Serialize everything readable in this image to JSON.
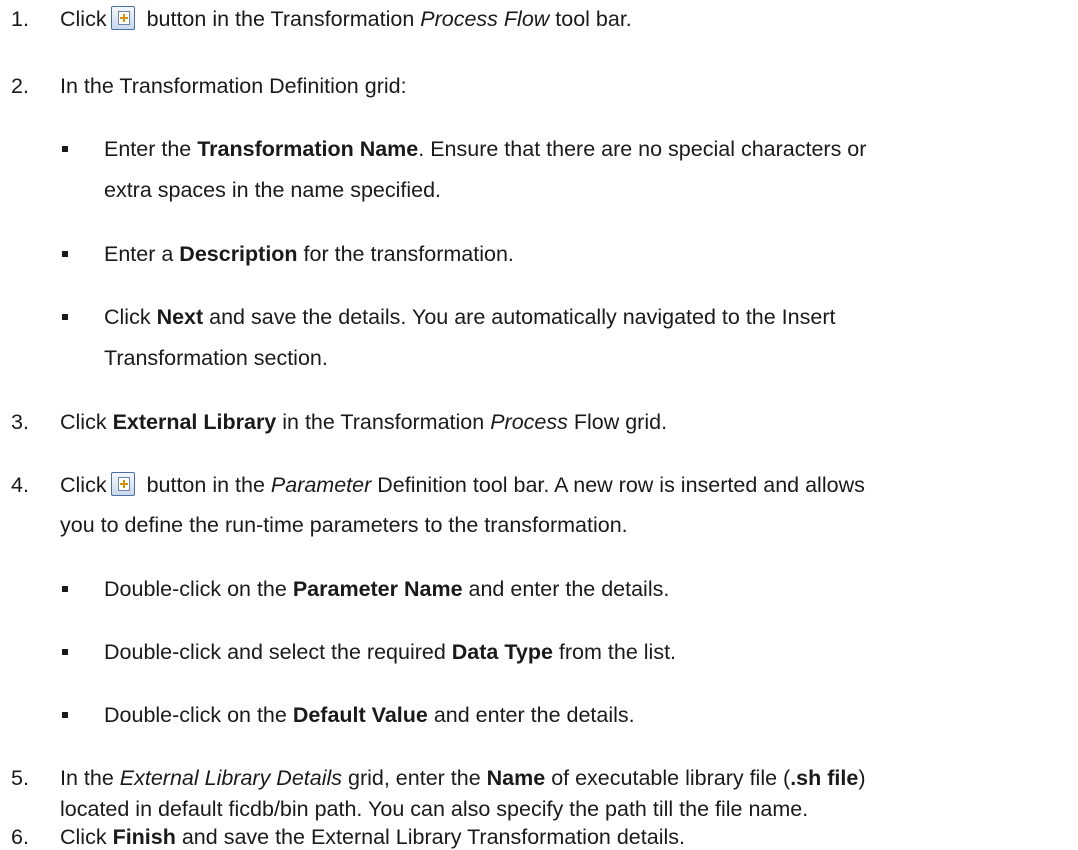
{
  "steps": [
    {
      "number": "1.",
      "t1": "Click",
      "icon": "add-page-icon",
      "t2": " button in the Transformation ",
      "t3": "Process Flow",
      "t4": " tool bar."
    },
    {
      "number": "2.",
      "t1": "In the Transformation Definition grid:"
    },
    {
      "number": "3.",
      "t1": "Click ",
      "b1": "External Library",
      "t2": " in the Transformation ",
      "i1": "Process",
      "t3": " Flow grid."
    },
    {
      "number": "4.",
      "t1": "Click",
      "icon": "add-page-icon",
      "t2": " button in the ",
      "i1": "Parameter",
      "t3": " Definition tool bar. A new row is inserted and allows",
      "line2": "you to define the run-time parameters to the transformation."
    },
    {
      "number": "5.",
      "t1": "In the ",
      "i1": "External Library Details",
      "t2": " grid, enter the ",
      "b1": "Name",
      "t3": " of executable library file (",
      "b2": ".sh file",
      "t4": ")",
      "line2": "located in default ficdb/bin path. You can also specify the path till the file name."
    },
    {
      "number": "6.",
      "t1": "Click ",
      "b1": "Finish",
      "t2": " and save the External Library Transformation details."
    }
  ],
  "step2_bullets": [
    {
      "t1": "Enter the ",
      "b1": "Transformation Name",
      "t2": ". Ensure that there are no special characters or",
      "line2": "extra spaces in the name specified."
    },
    {
      "t1": "Enter a ",
      "b1": "Description",
      "t2": " for the transformation."
    },
    {
      "t1": "Click ",
      "b1": "Next",
      "t2": " and save the details. You are automatically navigated to the Insert",
      "line2": "Transformation section."
    }
  ],
  "step4_bullets": [
    {
      "t1": "Double-click on the ",
      "b1": "Parameter Name",
      "t2": " and enter the details."
    },
    {
      "t1": "Double-click and select the required ",
      "b1": "Data Type",
      "t2": " from the list."
    },
    {
      "t1": "Double-click on the ",
      "b1": "Default Value",
      "t2": " and enter the details."
    }
  ]
}
